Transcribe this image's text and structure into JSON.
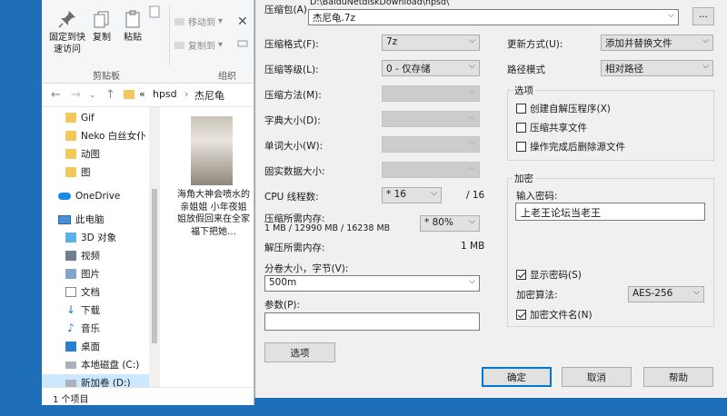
{
  "explorer": {
    "ribbon": {
      "pin_label": "固定到快\n速访问",
      "copy_label": "复制",
      "paste_label": "粘贴",
      "move_to_label": "移动到",
      "copy_to_label": "复制到",
      "clipboard_group": "剪贴板",
      "organize_group": "组织"
    },
    "address": {
      "overflow": "«",
      "crumbs": [
        "hpsd",
        "杰尼龟"
      ],
      "separator": "›"
    },
    "tree": [
      {
        "label": "Gif",
        "icon": "folder-icon"
      },
      {
        "label": "Neko 白丝女仆",
        "icon": "folder-icon"
      },
      {
        "label": "动图",
        "icon": "folder-icon"
      },
      {
        "label": "图",
        "icon": "folder-icon"
      },
      {
        "label": "OneDrive",
        "icon": "cloud-icon"
      },
      {
        "label": "此电脑",
        "icon": "computer-icon"
      },
      {
        "label": "3D 对象",
        "icon": "3d-objects-icon"
      },
      {
        "label": "视频",
        "icon": "video-icon"
      },
      {
        "label": "图片",
        "icon": "pictures-icon"
      },
      {
        "label": "文档",
        "icon": "documents-icon"
      },
      {
        "label": "下载",
        "icon": "download-icon"
      },
      {
        "label": "音乐",
        "icon": "music-icon"
      },
      {
        "label": "桌面",
        "icon": "desktop-icon"
      },
      {
        "label": "本地磁盘 (C:)",
        "icon": "drive-icon"
      },
      {
        "label": "新加卷 (D:)",
        "icon": "drive-icon"
      }
    ],
    "file": {
      "caption": "海角大神会喷水的亲姐姐 小年夜姐姐放假回来在全家福下把她…"
    },
    "status": "1 个项目"
  },
  "dialog": {
    "archive_label": "压缩包(A)",
    "archive_path": "D:\\BaiduNetdiskDownload\\hpsd\\",
    "archive_name": "杰尼龟.7z",
    "browse_label": "...",
    "format_label": "压缩格式(F):",
    "format_value": "7z",
    "level_label": "压缩等级(L):",
    "level_value": "0 - 仅存储",
    "method_label": "压缩方法(M):",
    "dict_label": "字典大小(D):",
    "word_label": "单词大小(W):",
    "solid_label": "固实数据大小:",
    "threads_label": "CPU 线程数:",
    "threads_value": "* 16",
    "threads_total": "/ 16",
    "mem_comp_label": "压缩所需内存:",
    "mem_comp_detail": "1 MB / 12990 MB / 16238 MB",
    "mem_pct_value": "* 80%",
    "mem_decomp_label": "解压所需内存:",
    "mem_decomp_value": "1 MB",
    "volume_label": "分卷大小，字节(V):",
    "volume_value": "500m",
    "params_label": "参数(P):",
    "params_value": "",
    "options_button": "选项",
    "update_label": "更新方式(U):",
    "update_value": "添加并替换文件",
    "path_label": "路径模式",
    "path_value": "相对路径",
    "options_group": "选项",
    "opt_sfx": "创建自解压程序(X)",
    "opt_shared": "压缩共享文件",
    "opt_delete": "操作完成后删除源文件",
    "encrypt_group": "加密",
    "password_label": "输入密码:",
    "password_value": "上老王论坛当老王",
    "show_password": "显示密码(S)",
    "enc_method_label": "加密算法:",
    "enc_method_value": "AES-256",
    "encrypt_names": "加密文件名(N)",
    "ok": "确定",
    "cancel": "取消",
    "help": "帮助"
  }
}
